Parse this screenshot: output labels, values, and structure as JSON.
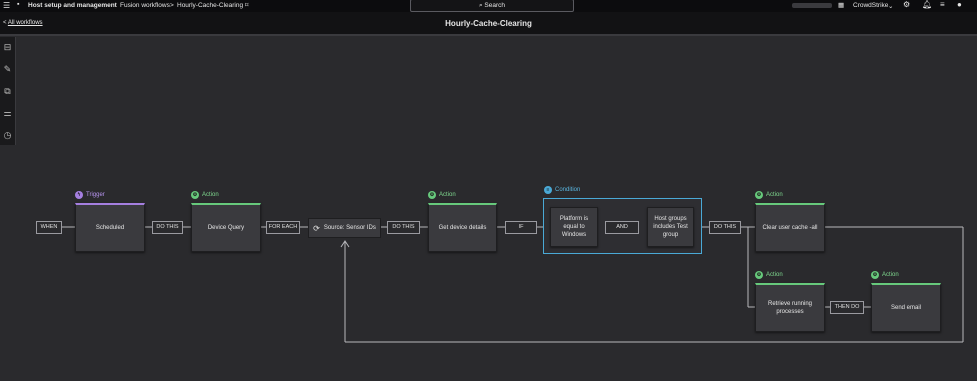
{
  "topbar": {
    "app": "Host setup and management",
    "crumb1": "Fusion workflows",
    "crumb_sep": ">",
    "crumb2": "Hourly-Cache-Clearing",
    "search_label": "Search",
    "tenant": "CrowdStrike"
  },
  "header": {
    "back_arrow": "<",
    "back_label": "All workflows",
    "title": "Hourly-Cache-Clearing"
  },
  "icons": [
    "menu-icon",
    "bookmark-icon",
    "grid-icon",
    "support-icon",
    "bell-icon",
    "list-icon",
    "user-icon",
    "layout-icon",
    "edit-icon",
    "copy-icon",
    "settings-icon",
    "history-icon",
    "refresh-icon"
  ],
  "colors": {
    "trigger": "#a57fe0",
    "action": "#67c97c",
    "condition": "#4aa9d6",
    "background": "#2a2a2d"
  },
  "workflow": {
    "when": "WHEN",
    "trigger_label": "Trigger",
    "trigger_node": "Scheduled",
    "do_this_1": "DO THIS",
    "action_label_1": "Action",
    "device_query": "Device Query",
    "for_each": "FOR EACH",
    "source": "Source: Sensor IDs",
    "do_this_2": "DO THIS",
    "action_label_2": "Action",
    "get_device_details": "Get device details",
    "if": "IF",
    "condition_label": "Condition",
    "platform_cond": "Platform is equal to Windows",
    "and": "AND",
    "group_cond": "Host groups includes Test group",
    "do_this_3": "DO THIS",
    "action_label_3": "Action",
    "clear_cache": "Clear user cache -all",
    "action_label_4": "Action",
    "retrieve_processes": "Retrieve running processes",
    "then_do": "THEN DO",
    "action_label_5": "Action",
    "send_email": "Send email"
  }
}
